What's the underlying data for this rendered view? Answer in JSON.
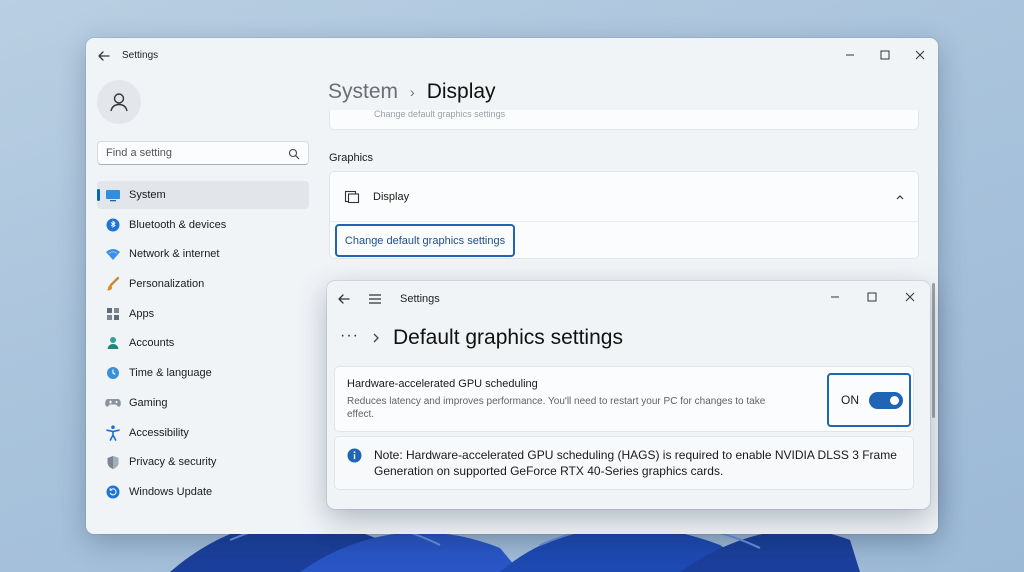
{
  "main_window": {
    "title": "Settings",
    "search_placeholder": "Find a setting",
    "nav": [
      {
        "label": "System",
        "icon": "monitor-icon",
        "active": true
      },
      {
        "label": "Bluetooth & devices",
        "icon": "bluetooth-icon"
      },
      {
        "label": "Network & internet",
        "icon": "wifi-icon"
      },
      {
        "label": "Personalization",
        "icon": "brush-icon"
      },
      {
        "label": "Apps",
        "icon": "apps-icon"
      },
      {
        "label": "Accounts",
        "icon": "person-icon"
      },
      {
        "label": "Time & language",
        "icon": "globe-clock-icon"
      },
      {
        "label": "Gaming",
        "icon": "gamepad-icon"
      },
      {
        "label": "Accessibility",
        "icon": "accessibility-icon"
      },
      {
        "label": "Privacy & security",
        "icon": "shield-icon"
      },
      {
        "label": "Windows Update",
        "icon": "update-icon"
      }
    ],
    "breadcrumb": {
      "parent": "System",
      "current": "Display"
    },
    "partial_card_text": "Change default graphics settings",
    "section_label": "Graphics",
    "display_row_label": "Display",
    "change_button_label": "Change default graphics settings"
  },
  "dialog_window": {
    "title": "Settings",
    "breadcrumb_overflow": "···",
    "heading": "Default graphics settings",
    "hags": {
      "title": "Hardware-accelerated GPU scheduling",
      "description": "Reduces latency and improves performance. You'll need to restart your PC for changes to take effect.",
      "toggle_label": "ON",
      "toggle_on": true
    },
    "note": "Note: Hardware-accelerated GPU scheduling (HAGS) is required to enable NVIDIA DLSS 3 Frame Generation on supported GeForce RTX 40-Series graphics cards."
  },
  "colors": {
    "accent": "#1f64b5",
    "active_indicator": "#0067c0"
  }
}
